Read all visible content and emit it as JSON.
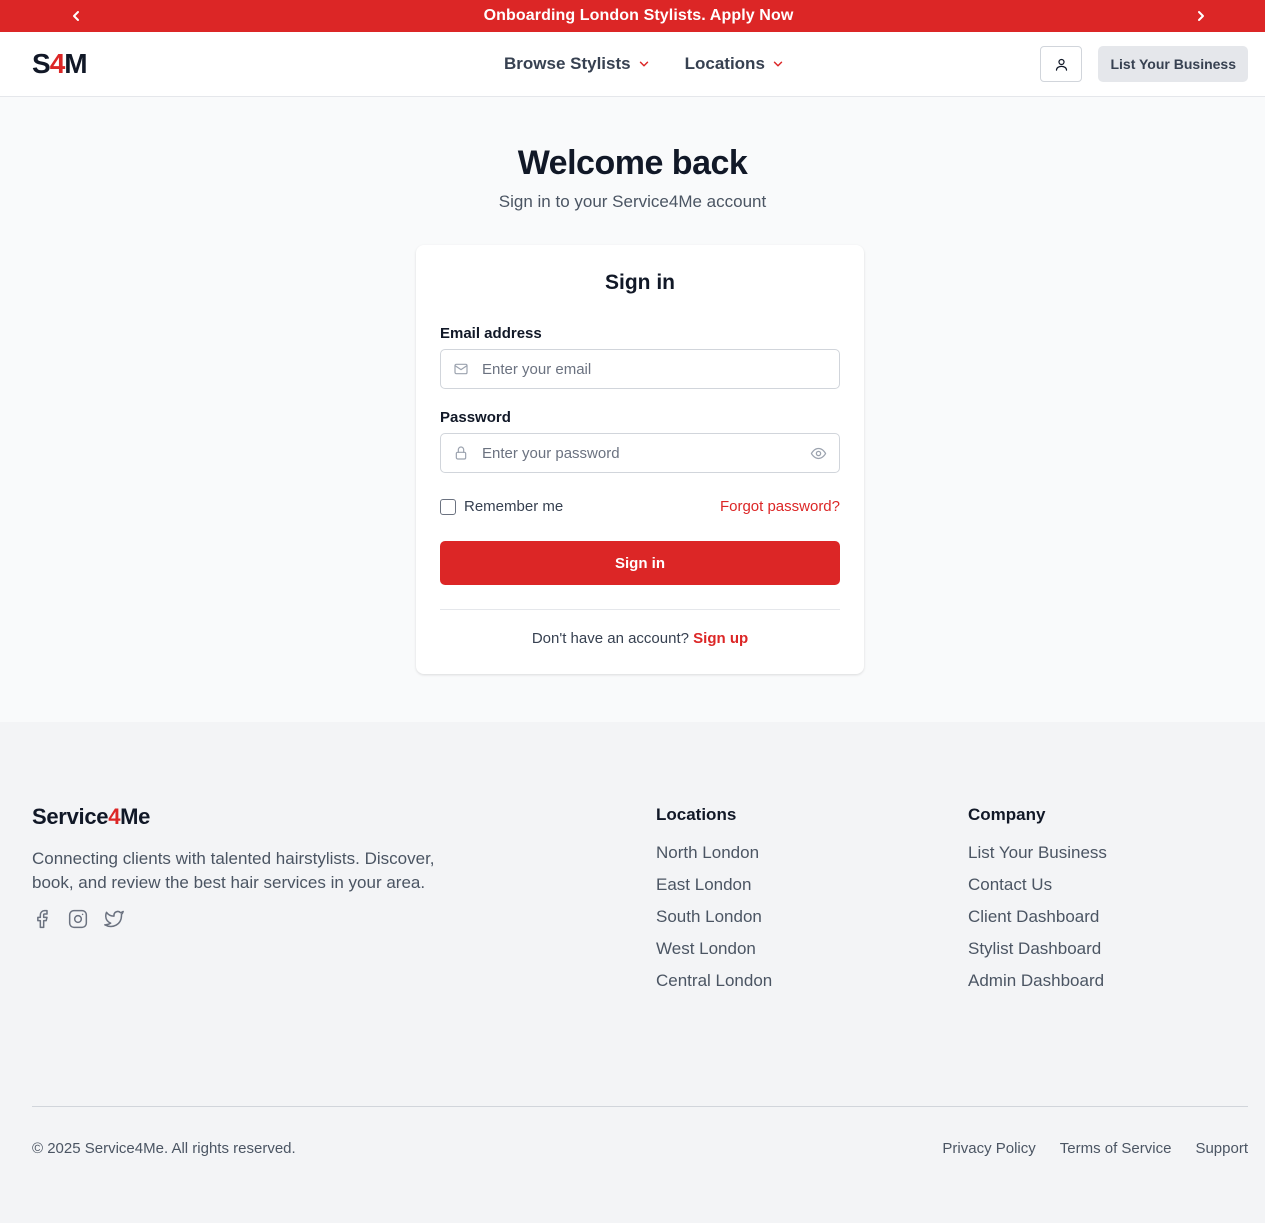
{
  "announcement": {
    "text": "Onboarding London Stylists. Apply Now",
    "prev_icon": "chevron-left-icon",
    "next_icon": "chevron-right-icon"
  },
  "header": {
    "logo": {
      "prefix": "S",
      "accent": "4",
      "suffix": "M"
    },
    "nav": [
      {
        "label": "Browse Stylists"
      },
      {
        "label": "Locations"
      }
    ],
    "account_icon": "user-icon",
    "list_business_label": "List Your Business"
  },
  "main": {
    "title": "Welcome back",
    "subtitle": "Sign in to your Service4Me account"
  },
  "form": {
    "title": "Sign in",
    "email_label": "Email address",
    "email_placeholder": "Enter your email",
    "email_value": "",
    "password_label": "Password",
    "password_placeholder": "Enter your password",
    "password_value": "",
    "remember_label": "Remember me",
    "remember_checked": false,
    "forgot_label": "Forgot password?",
    "submit_label": "Sign in",
    "no_account_text": "Don't have an account?",
    "signup_label": "Sign up"
  },
  "footer": {
    "brand": {
      "prefix": "Service",
      "accent": "4",
      "suffix": "Me"
    },
    "tagline": "Connecting clients with talented hairstylists. Discover, book, and review the best hair services in your area.",
    "socials": [
      "facebook-icon",
      "instagram-icon",
      "twitter-icon"
    ],
    "locations": {
      "heading": "Locations",
      "items": [
        "North London",
        "East London",
        "South London",
        "West London",
        "Central London"
      ]
    },
    "company": {
      "heading": "Company",
      "items": [
        "List Your Business",
        "Contact Us",
        "Client Dashboard",
        "Stylist Dashboard",
        "Admin Dashboard"
      ]
    },
    "copyright": "© 2025 Service4Me. All rights reserved.",
    "legal": [
      "Privacy Policy",
      "Terms of Service",
      "Support"
    ]
  },
  "colors": {
    "accent": "#dc2626",
    "text": "#111827",
    "muted": "#4b5563",
    "page_bg": "#f9fafb",
    "footer_bg": "#f3f4f6"
  }
}
